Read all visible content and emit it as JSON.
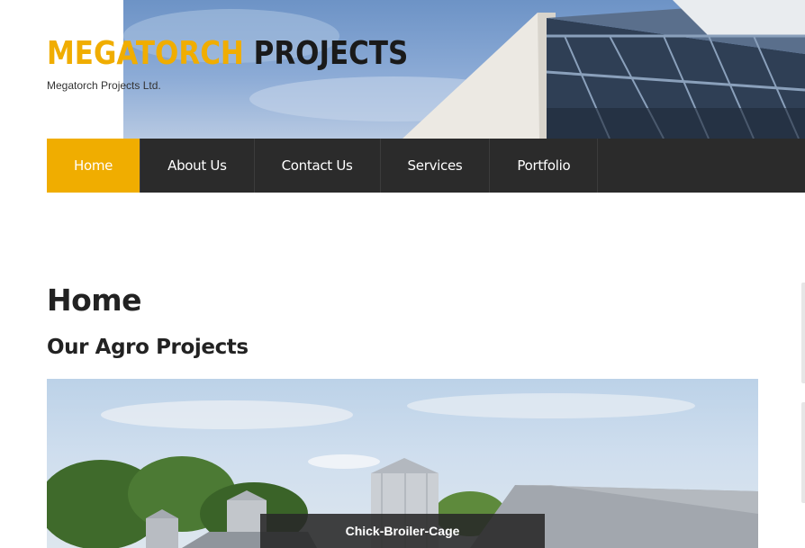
{
  "brand": {
    "title_part1": "MEGATORCH",
    "title_part2": "PROJECTS",
    "subtitle": "Megatorch Projects Ltd."
  },
  "nav": {
    "items": [
      {
        "label": "Home",
        "active": true
      },
      {
        "label": "About Us",
        "active": false
      },
      {
        "label": "Contact Us",
        "active": false
      },
      {
        "label": "Services",
        "active": false
      },
      {
        "label": "Portfolio",
        "active": false
      }
    ]
  },
  "main": {
    "page_title": "Home",
    "section_title": "Our Agro Projects",
    "slider": {
      "caption": "Chick-Broiler-Cage"
    }
  },
  "colors": {
    "accent": "#f0ad00",
    "nav_bg": "#2b2b2b",
    "text": "#222222"
  }
}
